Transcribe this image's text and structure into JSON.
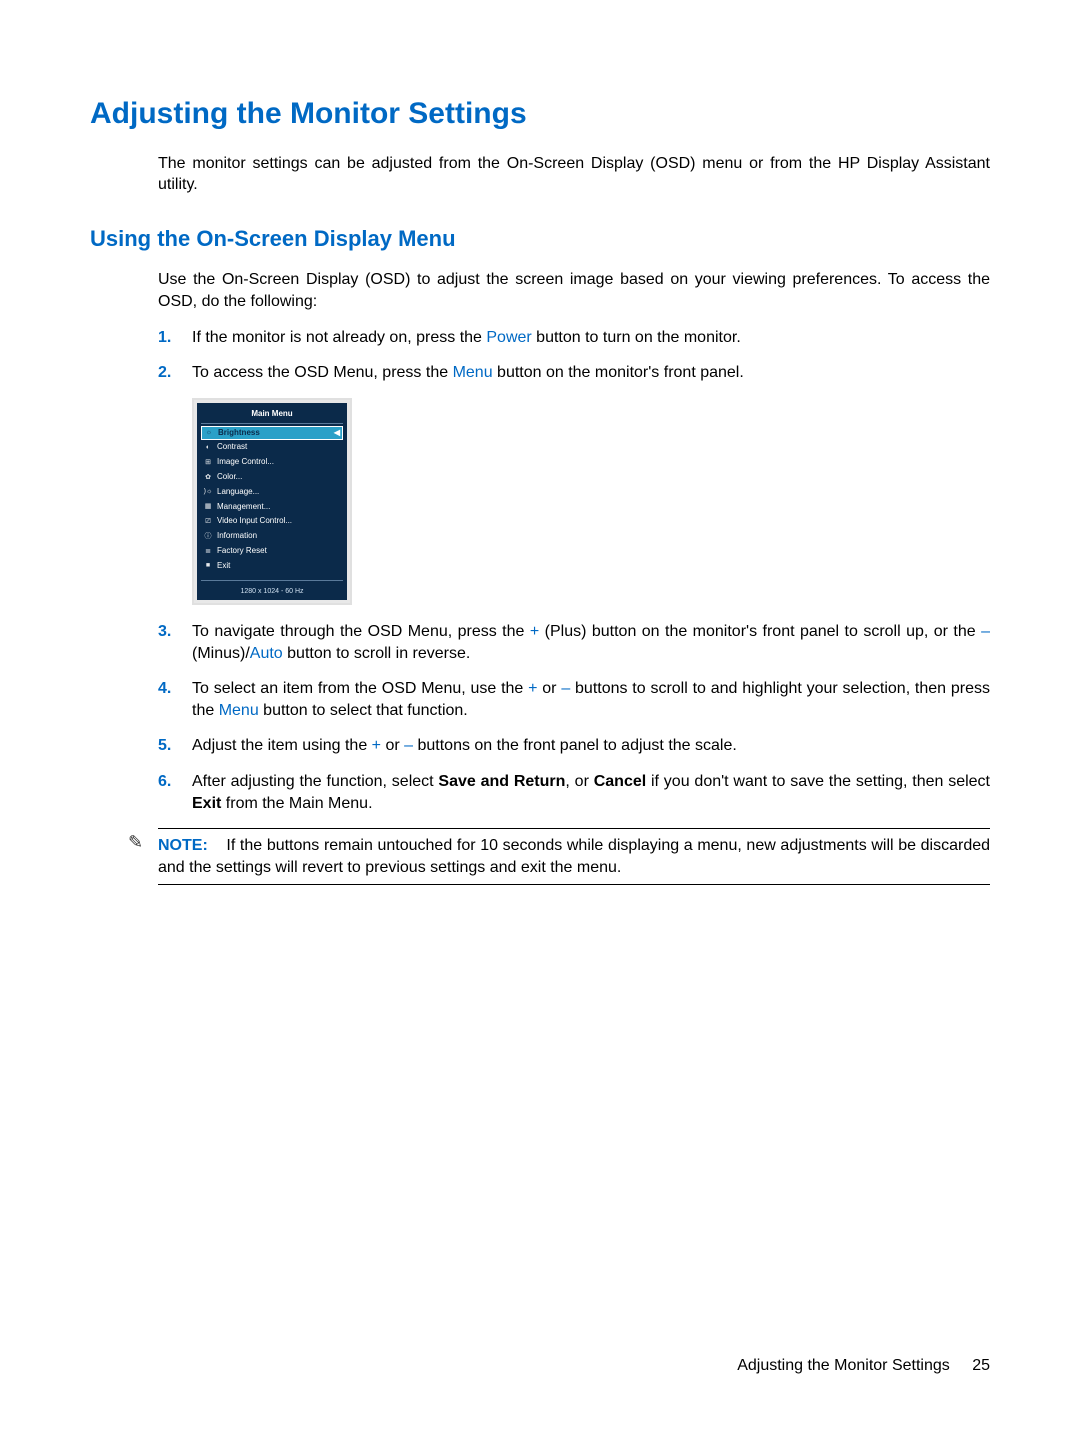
{
  "heading1": "Adjusting the Monitor Settings",
  "intro": "The monitor settings can be adjusted from the On-Screen Display (OSD) menu or from the HP Display Assistant utility.",
  "heading2": "Using the On-Screen Display Menu",
  "lead": "Use the On-Screen Display (OSD) to adjust the screen image based on your viewing preferences. To access the OSD, do the following:",
  "steps": {
    "s1": {
      "num": "1.",
      "a": "If the monitor is not already on, press the ",
      "kw": "Power",
      "b": " button to turn on the monitor."
    },
    "s2": {
      "num": "2.",
      "a": "To access the OSD Menu, press the ",
      "kw": "Menu",
      "b": " button on the monitor's front panel."
    },
    "s3": {
      "num": "3.",
      "a": "To navigate through the OSD Menu, press the ",
      "kw1": "+",
      "b": " (Plus) button on the monitor's front panel to scroll up, or the ",
      "kw2": "–",
      "c": " (Minus)/",
      "kw3": "Auto",
      "d": " button to scroll in reverse."
    },
    "s4": {
      "num": "4.",
      "a": "To select an item from the OSD Menu, use the ",
      "kw1": "+",
      "b": " or ",
      "kw2": "–",
      "c": " buttons to scroll to and highlight your selection, then press the ",
      "kw3": "Menu",
      "d": " button to select that function."
    },
    "s5": {
      "num": "5.",
      "a": "Adjust the item using the ",
      "kw1": "+",
      "b": " or ",
      "kw2": "–",
      "c": " buttons on the front panel to adjust the scale."
    },
    "s6": {
      "num": "6.",
      "a": "After adjusting the function, select ",
      "b1": "Save and Return",
      "b": ", or ",
      "b2": "Cancel",
      "c": " if you don't want to save the setting, then select ",
      "b3": "Exit",
      "d": " from the Main Menu."
    }
  },
  "osd": {
    "title": "Main Menu",
    "selected": "Brightness",
    "items": [
      "Contrast",
      "Image Control...",
      "Color...",
      "Language...",
      "Management...",
      "Video Input Control...",
      "Information",
      "Factory Reset",
      "Exit"
    ],
    "icons": [
      "◐",
      "⊞",
      "✿",
      ")☼",
      "▦",
      "⎚",
      "ⓘ",
      "≣",
      "■"
    ],
    "sel_icon": "☼",
    "resolution": "1280 x 1024 - 60 Hz"
  },
  "note": {
    "label": "NOTE:",
    "text": "If the buttons remain untouched for 10 seconds while displaying a menu, new adjustments will be discarded and the settings will revert to previous settings and exit the menu."
  },
  "footer": {
    "section": "Adjusting the Monitor Settings",
    "page": "25"
  }
}
